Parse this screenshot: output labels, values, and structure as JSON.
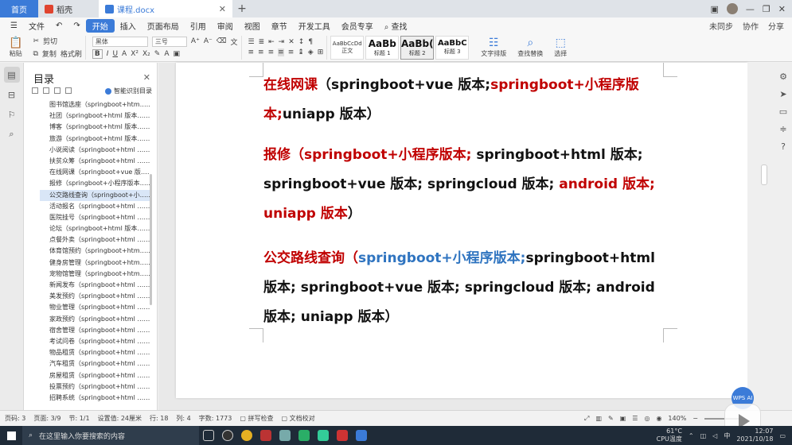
{
  "titlebar": {
    "tabs": [
      {
        "label": "首页"
      },
      {
        "label": "稻壳"
      },
      {
        "label": "课程.docx"
      }
    ]
  },
  "menubar": {
    "file": "文件",
    "items": [
      "开始",
      "插入",
      "页面布局",
      "引用",
      "审阅",
      "视图",
      "章节",
      "开发工具",
      "会员专享"
    ],
    "search": "查找",
    "right": [
      "未同步",
      "协作",
      "分享"
    ]
  },
  "ribbon": {
    "paste": "粘贴",
    "cut": "剪切",
    "copy": "复制",
    "format_painter": "格式刷",
    "font_name": "黑体",
    "font_size": "三号",
    "styles": [
      {
        "preview": "AaBbCcDd",
        "name": "正文"
      },
      {
        "preview": "AaBb",
        "name": "标题 1"
      },
      {
        "preview": "AaBb(",
        "name": "标题 2"
      },
      {
        "preview": "AaBbC",
        "name": "标题 3"
      }
    ],
    "text_layout": "文字排版",
    "find_replace": "查找替换",
    "select": "选择"
  },
  "toc": {
    "title": "目录",
    "smart": "智能识别目录",
    "items": [
      "图书馆选座（springboot+htm……",
      "社团（springboot+html 版本……",
      "博客（springboot+html 版本……",
      "旅游（springboot+html 版本……",
      "小说阅读（springboot+html ……",
      "扶贫众筹（springboot+html ……",
      "在线网课（springboot+vue 版……",
      "报修（springboot+小程序版本……",
      "公交路线查询（springboot+小……",
      "活动报名（springboot+html ……",
      "医院挂号（springboot+html ……",
      "论坛（springboot+html 版本……",
      "点餐外卖（springboot+html ……",
      "体育馆预约（springboot+htm……",
      "健身房管理（springboot+htm……",
      "宠物馆管理（springboot+htm……",
      "新闻发布（springboot+html ……",
      "美发预约（springboot+html ……",
      "物业管理（springboot+html ……",
      "家政预约（springboot+html ……",
      "宿舍管理（springboot+html ……",
      "考试问卷（springboot+html ……",
      "物品租赁（springboot+html ……",
      "汽车租赁（springboot+html ……",
      "房屋租赁（springboot+html ……",
      "投票预约（springboot+html ……",
      "招聘系统（springboot+html ……"
    ],
    "active_index": 8
  },
  "document": {
    "p1": [
      {
        "text": "在线网课",
        "color": "red"
      },
      {
        "text": "（springboot+vue 版本;",
        "color": "black"
      },
      {
        "text": "springboot+小程序版本;",
        "color": "red"
      },
      {
        "text": "uniapp 版本）",
        "color": "black"
      }
    ],
    "p2": [
      {
        "text": "报修",
        "color": "red"
      },
      {
        "text": "（springboot+小程序版本;",
        "color": "red"
      },
      {
        "text": " springboot+html 版本; springboot+vue 版本; springcloud 版本;",
        "color": "black"
      },
      {
        "text": " android 版本;",
        "color": "red"
      },
      {
        "text": " uniapp 版本",
        "color": "red"
      },
      {
        "text": "）",
        "color": "black"
      }
    ],
    "p3": [
      {
        "text": "公交路线查询",
        "color": "red"
      },
      {
        "text": "（",
        "color": "red"
      },
      {
        "text": "springboot+小程序版本;",
        "color": "blue"
      },
      {
        "text": "springboot+html 版本; springboot+vue 版本; springcloud 版本; android 版本; uniapp 版本）",
        "color": "black"
      }
    ]
  },
  "fab": "WPS AI",
  "status": {
    "page": "页码: 3",
    "pages": "页面: 3/9",
    "section": "节: 1/1",
    "setting": "设置值: 24厘米",
    "row": "行: 18",
    "col": "列: 4",
    "words": "字数: 1773",
    "spell": "拼写检查",
    "proof": "文档校对",
    "zoom": "140%"
  },
  "taskbar": {
    "search_placeholder": "在这里输入你要搜索的内容",
    "temp": "61°C",
    "cpu": "CPU温度",
    "ime": "中",
    "time": "12:07",
    "date": "2021/10/18"
  }
}
